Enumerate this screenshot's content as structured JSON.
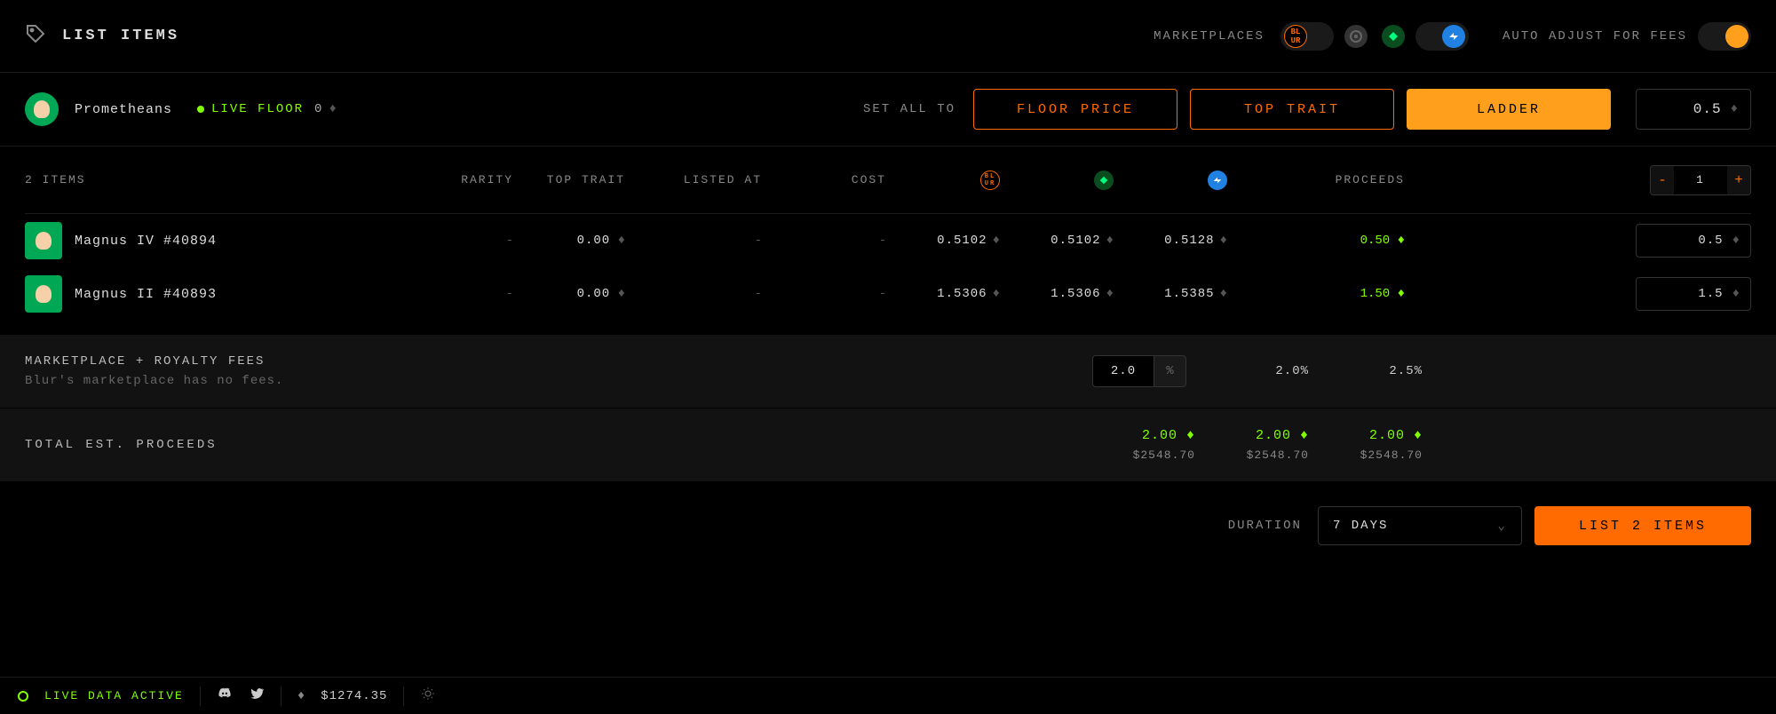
{
  "header": {
    "title": "LIST ITEMS",
    "marketplaces_label": "MARKETPLACES",
    "auto_adjust_label": "AUTO ADJUST FOR FEES"
  },
  "controls": {
    "collection_name": "Prometheans",
    "live_floor_label": "LIVE FLOOR",
    "floor_value": "0",
    "set_all_label": "SET ALL TO",
    "floor_price_btn": "FLOOR PRICE",
    "top_trait_btn": "TOP TRAIT",
    "ladder_btn": "LADDER",
    "global_price": "0.5"
  },
  "grid_head": {
    "items_count": "2 ITEMS",
    "rarity": "RARITY",
    "top_trait": "TOP TRAIT",
    "listed_at": "LISTED AT",
    "cost": "COST",
    "proceeds": "PROCEEDS",
    "qty": "1"
  },
  "rows": [
    {
      "name": "Magnus IV #40894",
      "rarity": "-",
      "top_trait": "0.00",
      "listed_at": "-",
      "cost": "-",
      "blur": "0.5102",
      "looks": "0.5102",
      "os": "0.5128",
      "proceeds": "0.50",
      "input": "0.5"
    },
    {
      "name": "Magnus II #40893",
      "rarity": "-",
      "top_trait": "0.00",
      "listed_at": "-",
      "cost": "-",
      "blur": "1.5306",
      "looks": "1.5306",
      "os": "1.5385",
      "proceeds": "1.50",
      "input": "1.5"
    }
  ],
  "fees": {
    "title": "MARKETPLACE + ROYALTY FEES",
    "subtitle": "Blur's marketplace has no fees.",
    "input_val": "2.0",
    "pct_sym": "%",
    "looks_fee": "2.0%",
    "os_fee": "2.5%"
  },
  "totals": {
    "title": "TOTAL EST. PROCEEDS",
    "cols": [
      {
        "eth": "2.00",
        "usd": "$2548.70"
      },
      {
        "eth": "2.00",
        "usd": "$2548.70"
      },
      {
        "eth": "2.00",
        "usd": "$2548.70"
      }
    ]
  },
  "footer": {
    "duration_label": "DURATION",
    "duration_value": "7 DAYS",
    "list_btn": "LIST 2 ITEMS"
  },
  "status": {
    "live_text": "LIVE DATA ACTIVE",
    "eth_price": "$1274.35"
  }
}
